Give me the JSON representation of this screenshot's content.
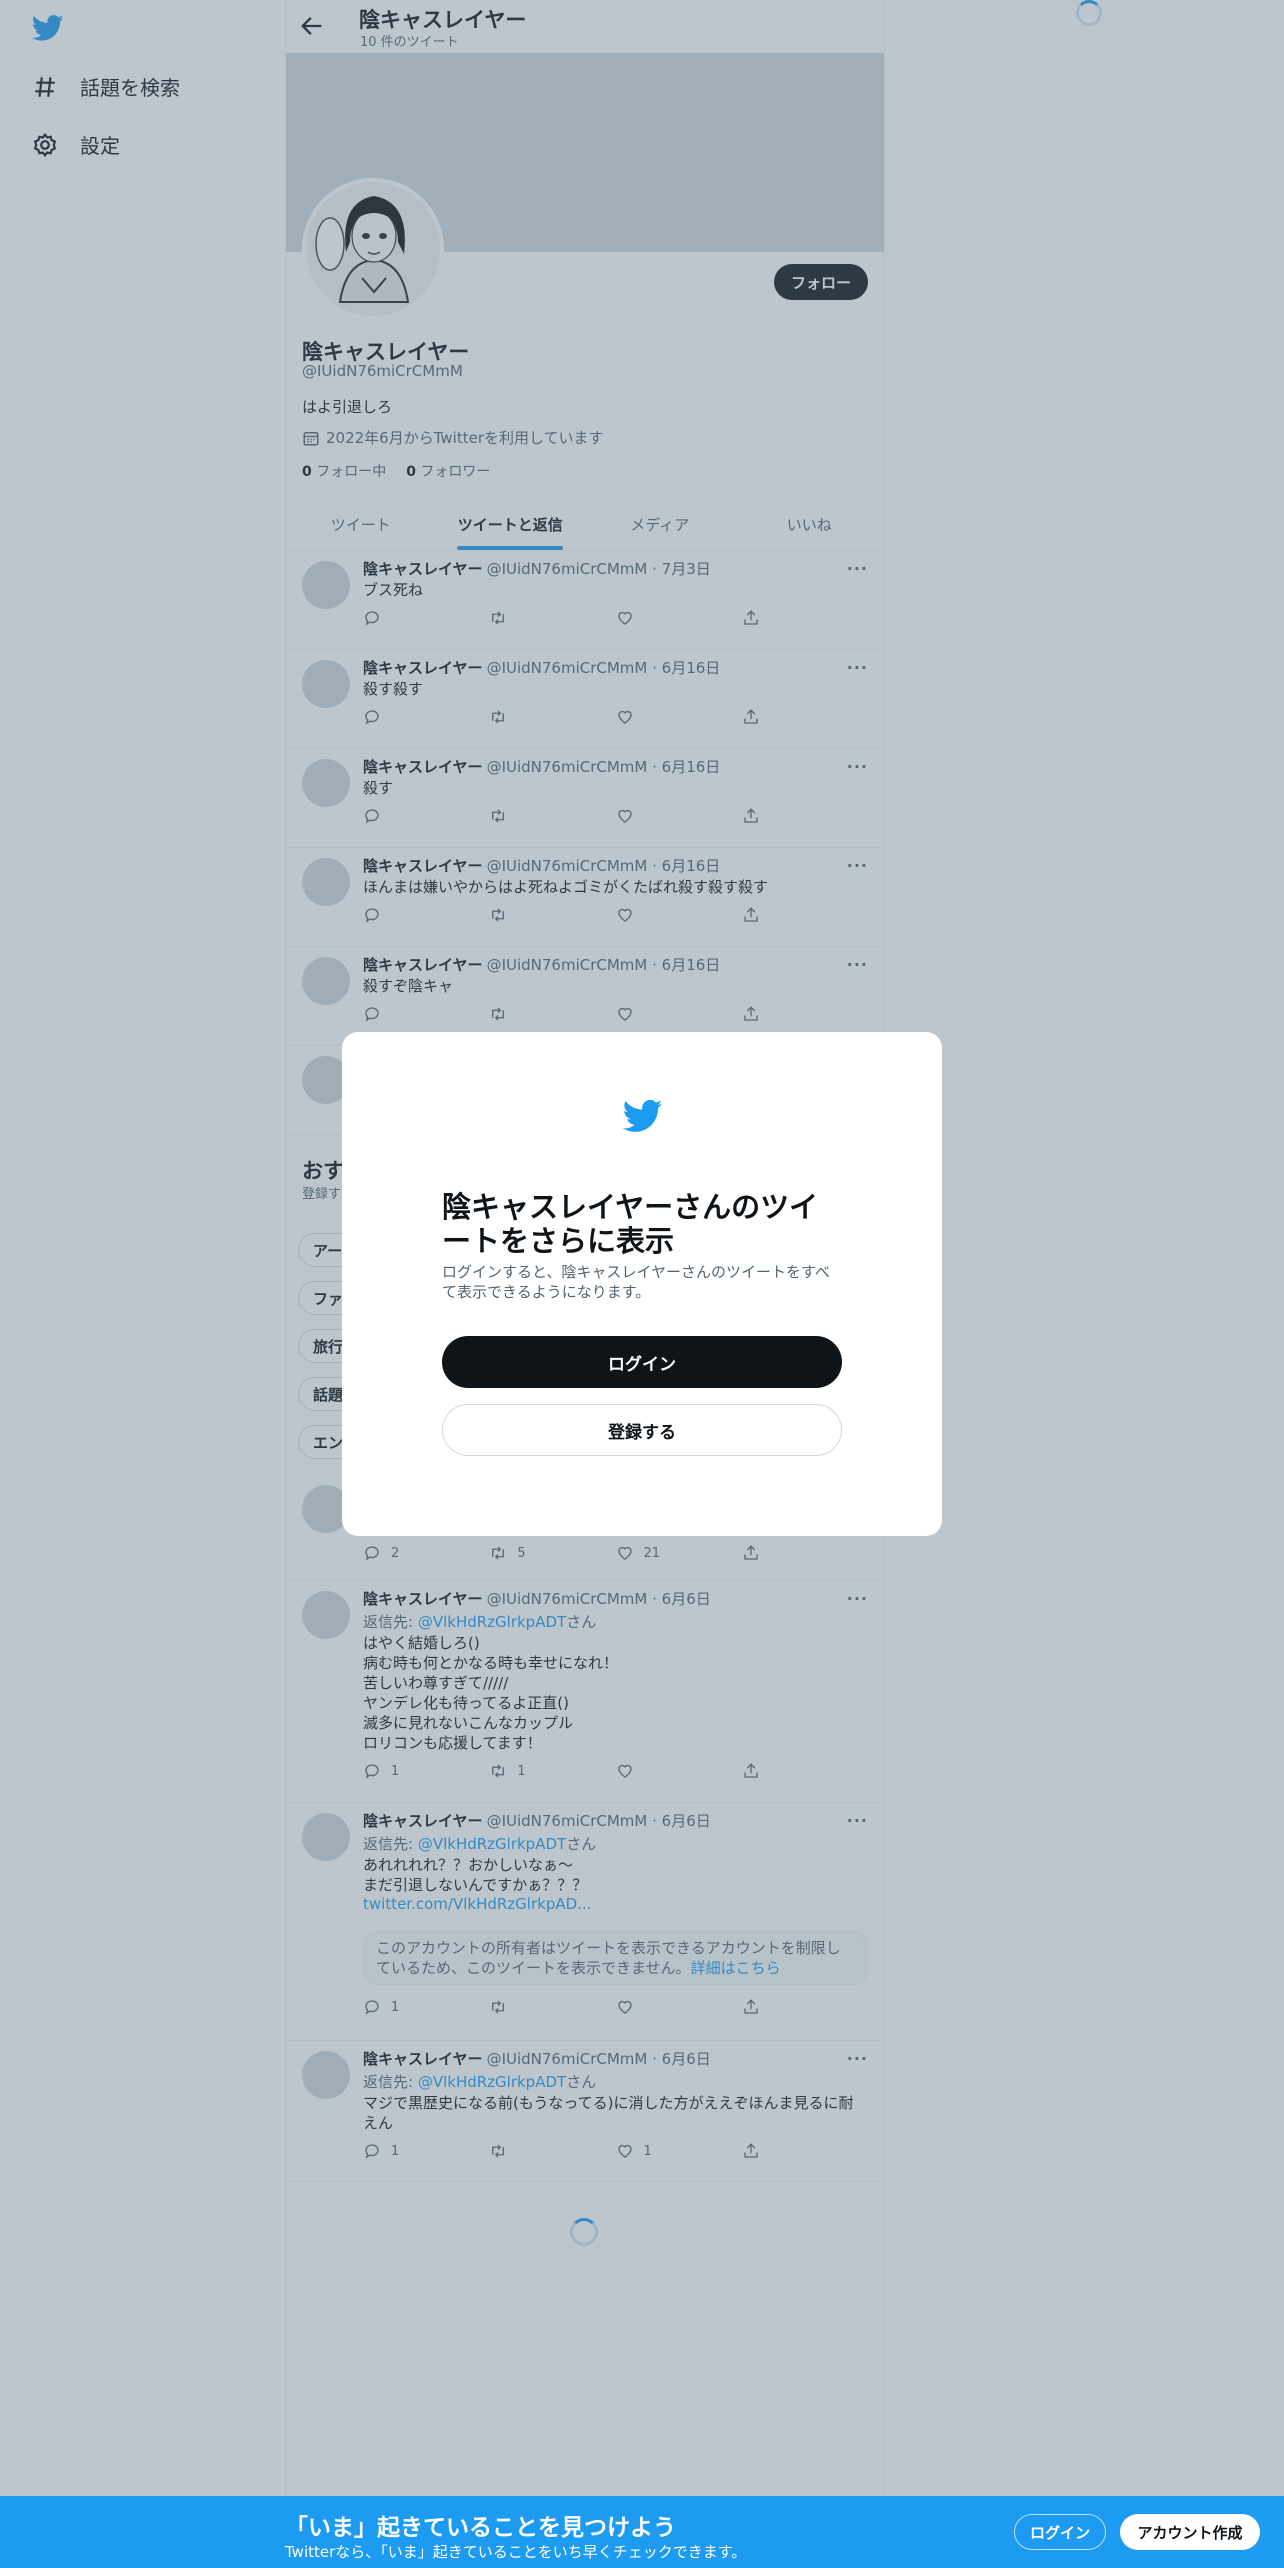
{
  "colors": {
    "accent": "#1d9bf0",
    "text": "#0f1419",
    "muted": "#536471",
    "overlay": "rgba(91,112,131,0.4)"
  },
  "sidebar": {
    "items": [
      {
        "icon": "hashtag-icon",
        "label": "話題を検索"
      },
      {
        "icon": "gear-icon",
        "label": "設定"
      }
    ]
  },
  "header": {
    "name": "陰キャスレイヤー",
    "tweet_count": "10 件のツイート"
  },
  "profile": {
    "follow_label": "フォロー",
    "name": "陰キャスレイヤー",
    "handle": "@IUidN76miCrCMmM",
    "bio": "はよ引退しろ",
    "joined": "2022年6月からTwitterを利用しています",
    "following_count": "0",
    "following_label": "フォロー中",
    "followers_count": "0",
    "followers_label": "フォロワー"
  },
  "tabs": [
    {
      "label": "ツイート"
    },
    {
      "label": "ツイートと返信"
    },
    {
      "label": "メディア"
    },
    {
      "label": "いいね"
    }
  ],
  "tweets": [
    {
      "name": "陰キャスレイヤー",
      "meta": "@IUidN76miCrCMmM · 7月3日",
      "text": "ブス死ね"
    },
    {
      "name": "陰キャスレイヤー",
      "meta": "@IUidN76miCrCMmM · 6月16日",
      "text": "殺す殺す"
    },
    {
      "name": "陰キャスレイヤー",
      "meta": "@IUidN76miCrCMmM · 6月16日",
      "text": "殺す"
    },
    {
      "name": "陰キャスレイヤー",
      "meta": "@IUidN76miCrCMmM · 6月16日",
      "text": "ほんまは嫌いやからはよ死ねよゴミがくたばれ殺す殺す殺す"
    },
    {
      "name": "陰キャスレイヤー",
      "meta": "@IUidN76miCrCMmM · 6月16日",
      "text": "殺すぞ陰キャ"
    }
  ],
  "recommend": {
    "title": "おす",
    "subtitle": "登録す",
    "chips": [
      "アー",
      "ファ",
      "旅行",
      "話題",
      "エン"
    ]
  },
  "partial_tweet": {
    "reply": "2",
    "retweet": "5",
    "like": "21"
  },
  "replies": [
    {
      "name": "陰キャスレイヤー",
      "meta": "@IUidN76miCrCMmM · 6月6日",
      "reply_prefix": "返信先: ",
      "reply_to": "@VlkHdRzGlrkpADT",
      "reply_suffix": "さん",
      "text": "はやく結婚しろ()\n病む時も何とかなる時も幸せになれ！\n苦しいわ尊すぎて/////\nヤンデレ化も待ってるよ正直()\n滅多に見れないこんなカップル\nロリコンも応援してます！",
      "reply": "1",
      "retweet": "1",
      "like": ""
    },
    {
      "name": "陰キャスレイヤー",
      "meta": "@IUidN76miCrCMmM · 6月6日",
      "reply_prefix": "返信先: ",
      "reply_to": "@VlkHdRzGlrkpADT",
      "reply_suffix": "さん",
      "text": "あれれれれ？？おかしいなぁ〜\nまだ引退しないんですかぁ？？？",
      "link": "twitter.com/VlkHdRzGlrkpAD...",
      "note": "このアカウントの所有者はツイートを表示できるアカウントを制限しているため、このツイートを表示できません。",
      "note_link": "詳細はこちら",
      "reply": "1",
      "retweet": "",
      "like": ""
    },
    {
      "name": "陰キャスレイヤー",
      "meta": "@IUidN76miCrCMmM · 6月6日",
      "reply_prefix": "返信先: ",
      "reply_to": "@VlkHdRzGlrkpADT",
      "reply_suffix": "さん",
      "text": "マジで黒歴史になる前(もうなってる)に消した方がええぞほんま見るに耐えん",
      "reply": "1",
      "retweet": "",
      "like": "1"
    }
  ],
  "modal": {
    "title": "陰キャスレイヤーさんのツイートをさらに表示",
    "subtitle": "ログインすると、陰キャスレイヤーさんのツイートをすべて表示できるようになります。",
    "login_label": "ログイン",
    "signup_label": "登録する"
  },
  "bottombar": {
    "title": "「いま」起きていることを見つけよう",
    "subtitle": "Twitterなら、「いま」起きていることをいち早くチェックできます。",
    "login_label": "ログイン",
    "signup_label": "アカウント作成"
  }
}
